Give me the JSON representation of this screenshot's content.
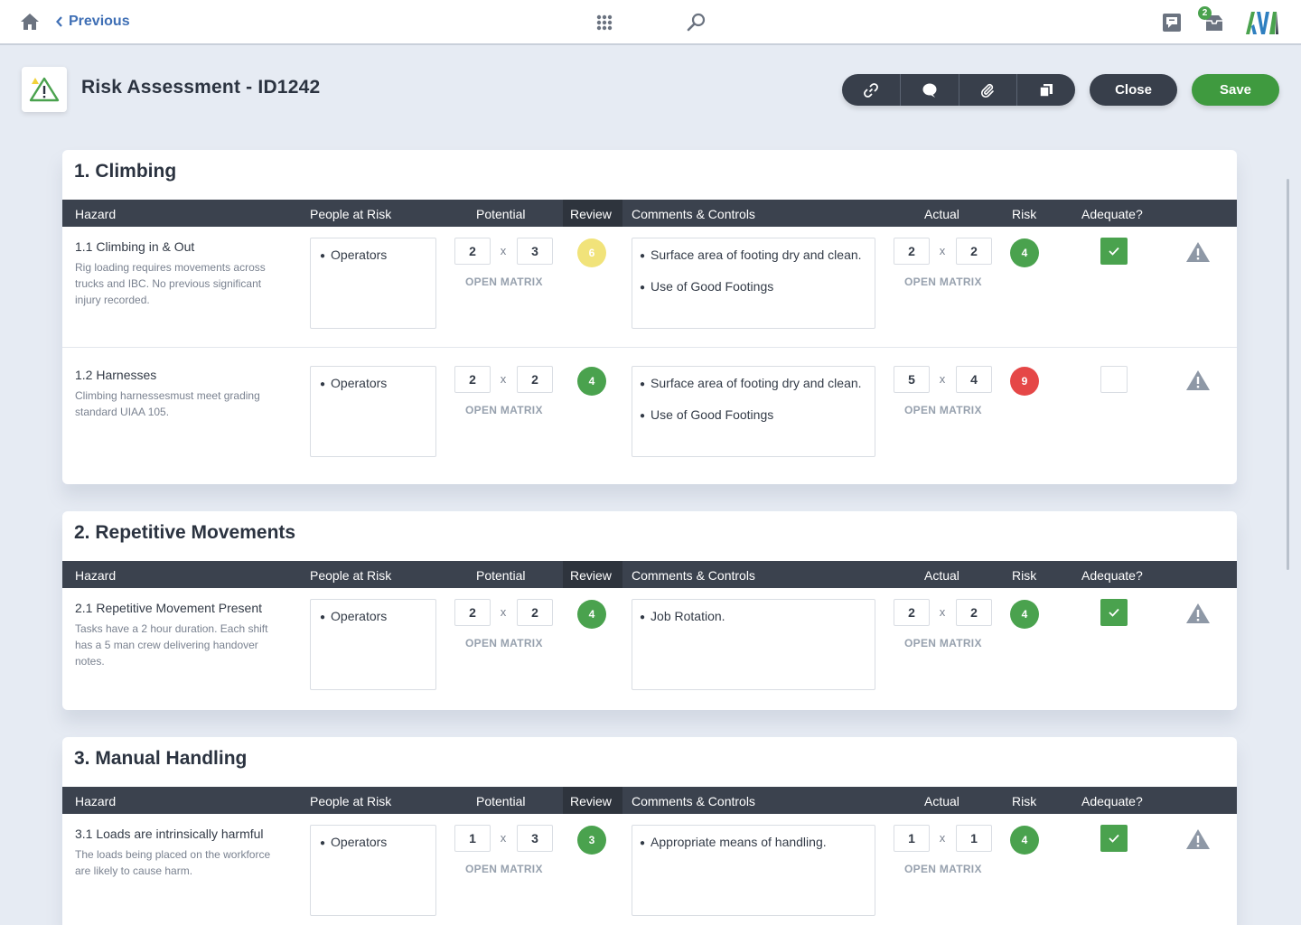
{
  "topbar": {
    "previous_label": "Previous",
    "inbox_badge": "2",
    "logo_text": "AVA"
  },
  "header": {
    "title": "Risk Assessment - ID1242",
    "close_label": "Close",
    "save_label": "Save"
  },
  "columns": {
    "hazard": "Hazard",
    "people": "People at Risk",
    "potential": "Potential",
    "review": "Review",
    "comments": "Comments & Controls",
    "actual": "Actual",
    "risk": "Risk",
    "adequate": "Adequate?"
  },
  "matrix_label": "OPEN MATRIX",
  "multiply_sign": "x",
  "colors": {
    "accent": "#3f6fb5",
    "save": "#3f9a3f",
    "dark": "#383f4b",
    "green": "#4aa24e",
    "yellow": "#f1e37a",
    "red": "#e54747"
  },
  "sections": [
    {
      "title": "1. Climbing",
      "rows": [
        {
          "title": "1.1 Climbing in & Out",
          "desc_lines": [
            "Rig loading requires movements across",
            "trucks and IBC. No previous significant",
            "injury recorded."
          ],
          "people": "Operators",
          "potential": [
            "2",
            "3"
          ],
          "review": "6",
          "review_color": "yellow",
          "comments": [
            "Surface area of footing dry and clean.",
            "Use of Good Footings"
          ],
          "actual": [
            "2",
            "2"
          ],
          "risk": "4",
          "risk_color": "green",
          "adequate": true
        },
        {
          "title": "1.2 Harnesses",
          "desc_lines": [
            "Climbing harnessesmust meet grading",
            "standard UIAA 105."
          ],
          "people": "Operators",
          "potential": [
            "2",
            "2"
          ],
          "review": "4",
          "review_color": "green",
          "comments": [
            "Surface area of footing dry and clean.",
            "Use of Good Footings"
          ],
          "actual": [
            "5",
            "4"
          ],
          "risk": "9",
          "risk_color": "red",
          "adequate": false
        }
      ]
    },
    {
      "title": "2. Repetitive Movements",
      "rows": [
        {
          "title": "2.1 Repetitive Movement Present",
          "desc_lines": [
            "Tasks have a 2 hour duration. Each shift",
            "has a 5 man crew delivering handover",
            "notes."
          ],
          "people": "Operators",
          "potential": [
            "2",
            "2"
          ],
          "review": "4",
          "review_color": "green",
          "comments": [
            "Job Rotation."
          ],
          "actual": [
            "2",
            "2"
          ],
          "risk": "4",
          "risk_color": "green",
          "adequate": true
        }
      ]
    },
    {
      "title": "3. Manual Handling",
      "rows": [
        {
          "title": "3.1 Loads are intrinsically harmful",
          "desc_lines": [
            "The loads being placed on the workforce",
            "are likely to cause harm."
          ],
          "people": "Operators",
          "potential": [
            "1",
            "3"
          ],
          "review": "3",
          "review_color": "green",
          "comments": [
            "Appropriate means of handling."
          ],
          "actual": [
            "1",
            "1"
          ],
          "risk": "4",
          "risk_color": "green",
          "adequate": true
        }
      ]
    }
  ]
}
